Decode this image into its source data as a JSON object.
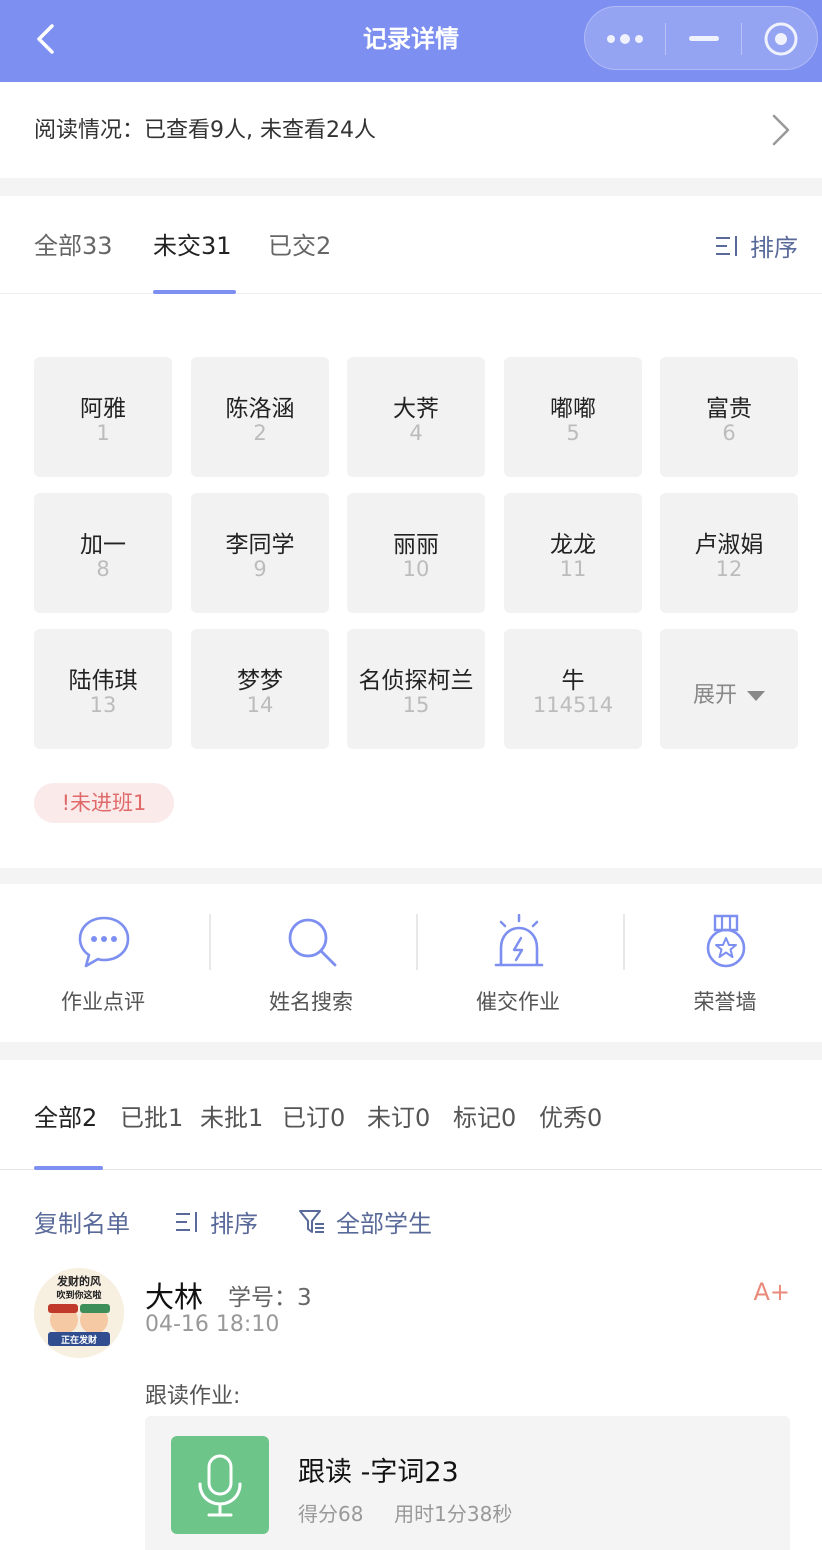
{
  "header": {
    "title": "记录详情"
  },
  "reading": {
    "text": "阅读情况：已查看9人, 未查看24人"
  },
  "tabs": [
    {
      "label": "全部33"
    },
    {
      "label": "未交31"
    },
    {
      "label": "已交2"
    }
  ],
  "sort_label": "排序",
  "students": [
    {
      "name": "阿雅",
      "no": "1"
    },
    {
      "name": "陈洛涵",
      "no": "2"
    },
    {
      "name": "大荠",
      "no": "4"
    },
    {
      "name": "嘟嘟",
      "no": "5"
    },
    {
      "name": "富贵",
      "no": "6"
    },
    {
      "name": "加一",
      "no": "8"
    },
    {
      "name": "李同学",
      "no": "9"
    },
    {
      "name": "丽丽",
      "no": "10"
    },
    {
      "name": "龙龙",
      "no": "11"
    },
    {
      "name": "卢淑娟",
      "no": "12"
    },
    {
      "name": "陆伟琪",
      "no": "13"
    },
    {
      "name": "梦梦",
      "no": "14"
    },
    {
      "name": "名侦探柯兰",
      "no": "15"
    },
    {
      "name": "牛",
      "no": "114514"
    }
  ],
  "expand_label": "展开",
  "not_joined": "!未进班1",
  "tools": [
    {
      "label": "作业点评",
      "icon": "chat-bubble-icon"
    },
    {
      "label": "姓名搜索",
      "icon": "search-icon"
    },
    {
      "label": "催交作业",
      "icon": "alarm-icon"
    },
    {
      "label": "荣誉墙",
      "icon": "medal-icon"
    }
  ],
  "filter_tabs": [
    {
      "label": "全部2"
    },
    {
      "label": "已批1"
    },
    {
      "label": "未批1"
    },
    {
      "label": "已订0"
    },
    {
      "label": "未订0"
    },
    {
      "label": "标记0"
    },
    {
      "label": "优秀0"
    }
  ],
  "actions": {
    "copy": "复制名单",
    "sort": "排序",
    "filter": "全部学生"
  },
  "record": {
    "avatar_text_top": "发财的风",
    "avatar_text_mid": "吹到你这啦",
    "avatar_text_bottom": "正在发财",
    "name": "大林",
    "student_no": "学号：3",
    "time": "04-16 18:10",
    "grade": "A+",
    "hw_label": "跟读作业:",
    "hw_title": "跟读 -字词23",
    "hw_score": "得分68",
    "hw_duration": "用时1分38秒"
  },
  "colors": {
    "accent": "#7d8ff0",
    "link": "#596a9a",
    "mic_green": "#6dc58a",
    "grade": "#e98a7a"
  }
}
